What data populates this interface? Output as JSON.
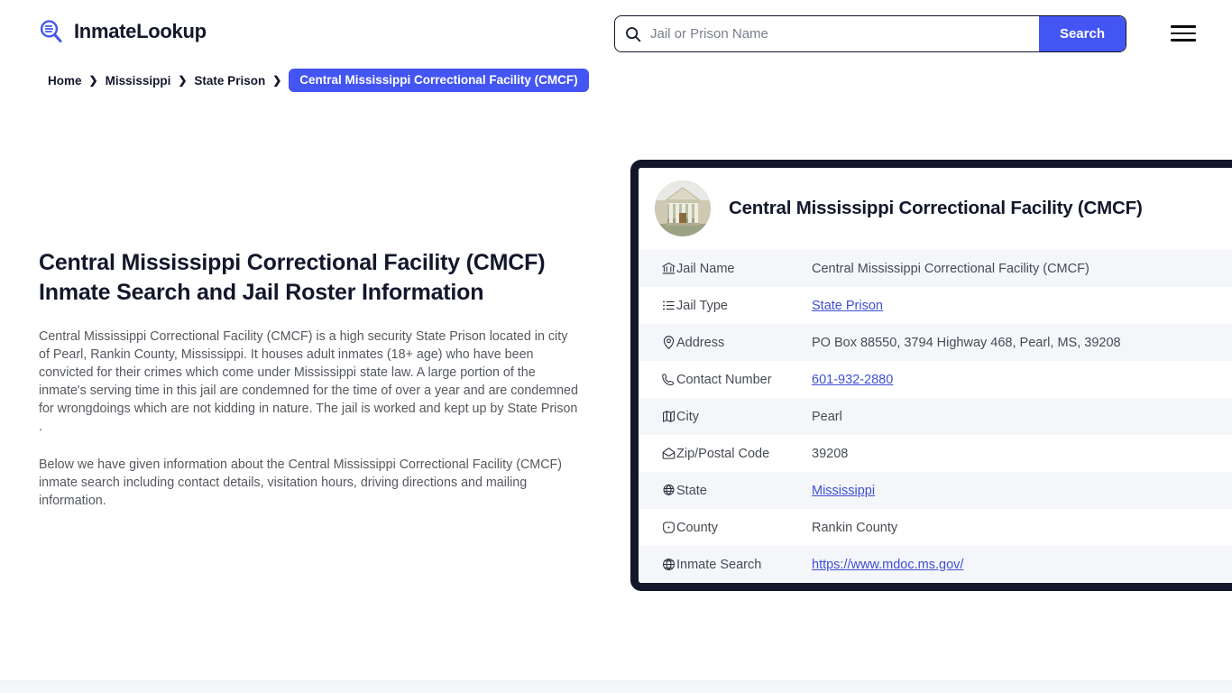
{
  "header": {
    "brand_name": "InmateLookup",
    "brand_logo_icon": "magnifier-logo-icon",
    "search": {
      "placeholder": "Jail or Prison Name",
      "value": "",
      "icon": "search-icon",
      "button_label": "Search"
    },
    "menu_icon": "hamburger-menu-icon"
  },
  "breadcrumb": {
    "items": [
      {
        "label": "Home",
        "current": false
      },
      {
        "label": "Mississippi",
        "current": false
      },
      {
        "label": "State Prison",
        "current": false
      },
      {
        "label": "Central Mississippi Correctional Facility (CMCF)",
        "current": true
      }
    ],
    "separator": "❯"
  },
  "main": {
    "page_title": "Central Mississippi Correctional Facility (CMCF) Inmate Search and Jail Roster Information",
    "paragraph_1": "Central Mississippi Correctional Facility (CMCF) is a high security State Prison located in city of Pearl, Rankin County, Mississippi. It houses adult inmates (18+ age) who have been convicted for their crimes which come under Mississippi state law. A large portion of the inmate's serving time in this jail are condemned for the time of over a year and are condemned for wrongdoings which are not kidding in nature. The jail is worked and kept up by State Prison .",
    "paragraph_2": "Below we have given information about the Central Mississippi Correctional Facility (CMCF) inmate search including contact details, visitation hours, driving directions and mailing information."
  },
  "info_card": {
    "avatar_icon": "facility-building-photo",
    "title": "Central Mississippi Correctional Facility (CMCF)",
    "rows": [
      {
        "icon": "bank-icon",
        "label": "Jail Name",
        "value": "Central Mississippi Correctional Facility (CMCF)",
        "link": false
      },
      {
        "icon": "list-icon",
        "label": "Jail Type",
        "value": "State Prison",
        "link": true
      },
      {
        "icon": "map-pin-icon",
        "label": "Address",
        "value": "PO Box 88550, 3794 Highway 468, Pearl, MS, 39208",
        "link": false
      },
      {
        "icon": "phone-icon",
        "label": "Contact Number",
        "value": "601-932-2880",
        "link": true
      },
      {
        "icon": "map-icon",
        "label": "City",
        "value": "Pearl",
        "link": false
      },
      {
        "icon": "envelope-icon",
        "label": "Zip/Postal Code",
        "value": "39208",
        "link": false
      },
      {
        "icon": "globe-pin-icon",
        "label": "State",
        "value": "Mississippi",
        "link": true
      },
      {
        "icon": "county-icon",
        "label": "County",
        "value": "Rankin County",
        "link": false
      },
      {
        "icon": "globe-icon",
        "label": "Inmate Search",
        "value": "https://www.mdoc.ms.gov/",
        "link": true
      }
    ]
  },
  "colors": {
    "accent_blue": "#4355f2",
    "link_blue": "#3d4fd6",
    "dark_navy": "#12172b",
    "row_shaded": "#f5f6fa",
    "body_text": "#55595f"
  }
}
